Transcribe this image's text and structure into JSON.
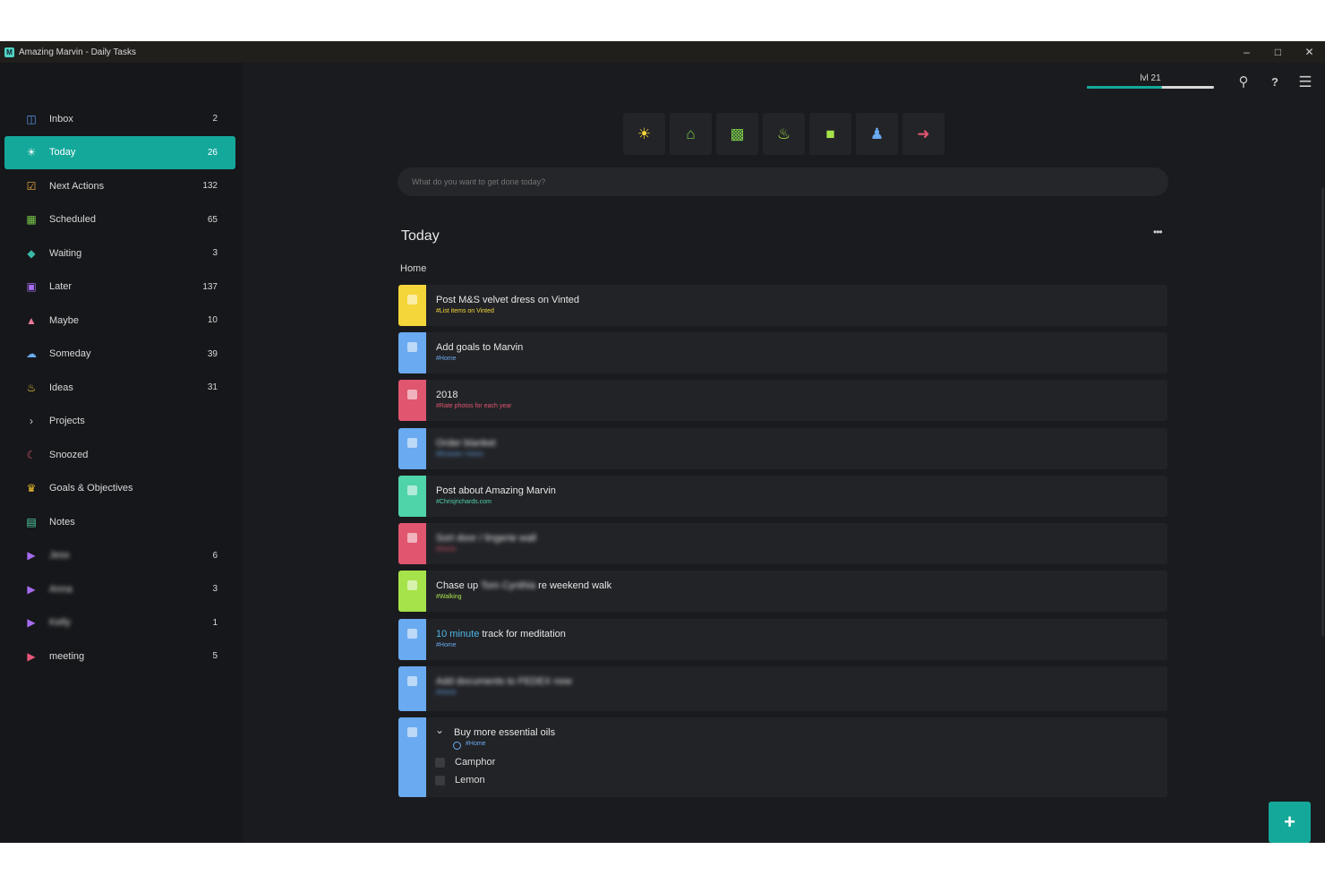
{
  "window": {
    "title": "Amazing Marvin - Daily Tasks",
    "app_icon": "M"
  },
  "sidebar": {
    "items": [
      {
        "label": "Inbox",
        "count": "2",
        "icon": "inbox-icon",
        "color": "#5b9bf0"
      },
      {
        "label": "Today",
        "count": "26",
        "icon": "sun-icon",
        "color": "#ffffff"
      },
      {
        "label": "Next Actions",
        "count": "132",
        "icon": "checkbox-icon",
        "color": "#f0b040"
      },
      {
        "label": "Scheduled",
        "count": "65",
        "icon": "calendar-icon",
        "color": "#7acb4a"
      },
      {
        "label": "Waiting",
        "count": "3",
        "icon": "layers-icon",
        "color": "#3bb8a8"
      },
      {
        "label": "Later",
        "count": "137",
        "icon": "later-calendar-icon",
        "color": "#a56cf0"
      },
      {
        "label": "Maybe",
        "count": "10",
        "icon": "basket-icon",
        "color": "#e87a9a"
      },
      {
        "label": "Someday",
        "count": "39",
        "icon": "cloud-icon",
        "color": "#6aaaf0"
      },
      {
        "label": "Ideas",
        "count": "31",
        "icon": "lightbulb-icon",
        "color": "#f5d63a"
      },
      {
        "label": "Projects",
        "count": "",
        "icon": "chevron-right-icon",
        "color": "#cccccc"
      },
      {
        "label": "Snoozed",
        "count": "",
        "icon": "snooze-icon",
        "color": "#e0566e"
      },
      {
        "label": "Goals & Objectives",
        "count": "",
        "icon": "trophy-icon",
        "color": "#f2c230"
      },
      {
        "label": "Notes",
        "count": "",
        "icon": "note-icon",
        "color": "#4fd3a8"
      },
      {
        "label": "Jess",
        "count": "6",
        "icon": "label-tag-icon",
        "color": "#a56cf0",
        "blurred": true
      },
      {
        "label": "Anna",
        "count": "3",
        "icon": "label-tag-icon",
        "color": "#a56cf0",
        "blurred": true
      },
      {
        "label": "Kelly",
        "count": "1",
        "icon": "label-tag-icon",
        "color": "#a56cf0",
        "blurred": true
      },
      {
        "label": "meeting",
        "count": "5",
        "icon": "label-tag-icon",
        "color": "#e8567a"
      }
    ]
  },
  "header": {
    "level": "lvl 21",
    "level_progress": 0.59
  },
  "quickbar": [
    {
      "icon": "sun-icon",
      "color": "#f5d63a"
    },
    {
      "icon": "home-icon",
      "color": "#7acb4a"
    },
    {
      "icon": "calendar-arrow-icon",
      "color": "#7acb4a"
    },
    {
      "icon": "lightbulb-icon",
      "color": "#a6e34a"
    },
    {
      "icon": "sticky-note-icon",
      "color": "#a6e34a"
    },
    {
      "icon": "people-icon",
      "color": "#6aaaf0"
    },
    {
      "icon": "running-icon",
      "color": "#e0566e"
    }
  ],
  "add_task": {
    "placeholder": "What do you want to get done today?"
  },
  "main": {
    "section_title": "Today",
    "more": "•••",
    "group": "Home",
    "tasks": [
      {
        "title": "Post M&S velvet dress on Vinted",
        "tag": "#List items on Vinted",
        "color": "#f5d63a",
        "tag_color": "#f5d63a"
      },
      {
        "title": "Add goals to Marvin",
        "tag": "#Home",
        "color": "#6aaaf0",
        "tag_color": "#6aaaf0"
      },
      {
        "title": "2018",
        "tag": "#Rate photos for each year",
        "color": "#e0566e",
        "tag_color": "#e0566e"
      },
      {
        "title": "Order blanket",
        "tag": "#Errands / Home",
        "color": "#6aaaf0",
        "tag_color": "#6aaaf0",
        "blurred": true
      },
      {
        "title": "Post about Amazing Marvin",
        "tag": "#Chrisjrichards.com",
        "color": "#4fd3a8",
        "tag_color": "#4fd3a8"
      },
      {
        "title": "Sort door / lingerie wall",
        "tag": "#Home",
        "color": "#e0566e",
        "tag_color": "#e0566e",
        "blurred": true
      },
      {
        "title_pre": "Chase up ",
        "title_blur": "Tom Cynthia",
        "title_post": " re weekend walk",
        "tag": "#Walking",
        "color": "#a6e34a",
        "tag_color": "#a6e34a"
      },
      {
        "title_highlight": "10 minute",
        "title_post": " track for meditation",
        "tag": "#Home",
        "color": "#6aaaf0",
        "tag_color": "#6aaaf0",
        "highlight_color": "#4fb6e6"
      },
      {
        "title": "Add documents to FEDEX now",
        "tag": "#Home",
        "color": "#6aaaf0",
        "tag_color": "#6aaaf0",
        "blurred": true
      },
      {
        "title": "Buy more essential oils",
        "tag": "#Home",
        "color": "#6aaaf0",
        "tag_color": "#6aaaf0",
        "subtasks": [
          "Camphor",
          "Lemon"
        ]
      }
    ]
  }
}
